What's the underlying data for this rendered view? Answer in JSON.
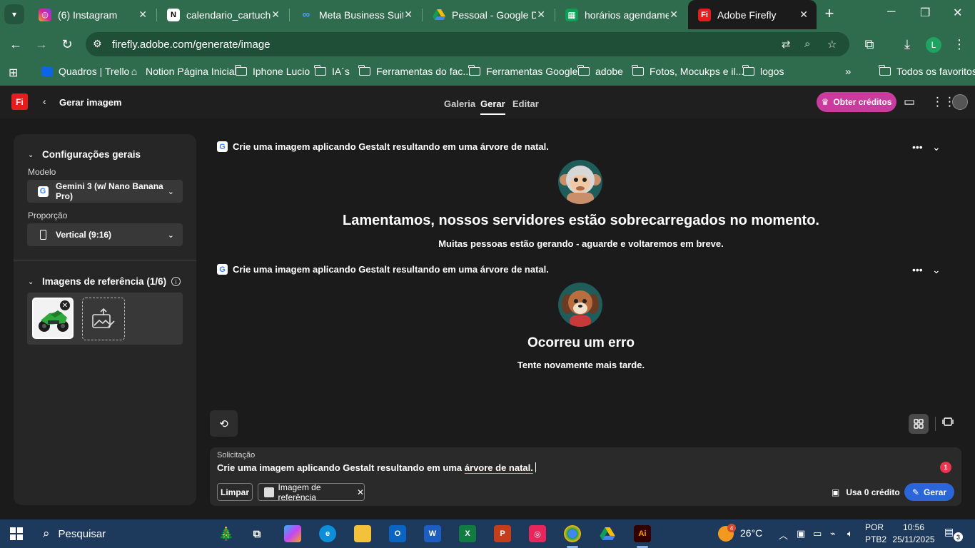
{
  "browser": {
    "tabs": [
      {
        "title": "(6) Instagram",
        "icon": "instagram-icon",
        "color": "#d6249f"
      },
      {
        "title": "calendario_cartucho_",
        "icon": "notion-icon",
        "color": "#ffffff"
      },
      {
        "title": "Meta Business Suite",
        "icon": "meta-icon",
        "color": "#1877f2"
      },
      {
        "title": "Pessoal - Google Drive",
        "icon": "google-drive-icon",
        "color": "#34a853"
      },
      {
        "title": "horários agendament",
        "icon": "google-sheets-icon",
        "color": "#0f9d58"
      },
      {
        "title": "Adobe Firefly",
        "icon": "adobe-firefly-icon",
        "color": "#e81c1c",
        "active": true
      }
    ],
    "url": "firefly.adobe.com/generate/image",
    "profile_initial": "L",
    "bookmarks": [
      {
        "label": "Quadros | Trello",
        "icon": "trello-icon"
      },
      {
        "label": "Notion Página Inicial",
        "icon": "home-icon"
      },
      {
        "label": "Iphone Lucio",
        "icon": "folder-icon"
      },
      {
        "label": "IA´s",
        "icon": "folder-icon"
      },
      {
        "label": "Ferramentas do fac...",
        "icon": "folder-icon"
      },
      {
        "label": "Ferramentas Google",
        "icon": "folder-icon"
      },
      {
        "label": "adobe",
        "icon": "folder-icon"
      },
      {
        "label": "Fotos, Mocukps e il...",
        "icon": "folder-icon"
      },
      {
        "label": "logos",
        "icon": "folder-icon"
      }
    ],
    "all_bookmarks": "Todos os favoritos"
  },
  "firefly": {
    "logo_text": "Fi",
    "page_title": "Gerar imagem",
    "nav": [
      "Galeria",
      "Gerar",
      "Editar"
    ],
    "active_nav": "Gerar",
    "credits_button": "Obter créditos",
    "accent": "#c93c9e",
    "settings": {
      "general_title": "Configurações gerais",
      "model_label": "Modelo",
      "model_value": "Gemini 3 (w/ Nano Banana Pro)",
      "ratio_label": "Proporção",
      "ratio_value": "Vertical (9:16)",
      "ref_title": "Imagens de referência (1/6)"
    },
    "results": [
      {
        "prompt": "Crie uma imagem aplicando Gestalt resultando em uma árvore de natal.",
        "title": "Lamentamos, nossos servidores estão sobrecarregados no momento.",
        "subtitle": "Muitas pessoas estão gerando - aguarde e voltaremos em breve.",
        "mascot": "monkey-mascot"
      },
      {
        "prompt": "Crie uma imagem aplicando Gestalt resultando em uma árvore de natal.",
        "title": "Ocorreu um erro",
        "subtitle": "Tente novamente mais tarde.",
        "mascot": "dog-mascot"
      }
    ],
    "prompt_box": {
      "label": "Solicitação",
      "text_start": "Crie uma imagem aplicando Gestalt resultando em uma ",
      "text_underlined": "árvore de natal.",
      "badge": "1",
      "clear_button": "Limpar",
      "ref_chip": "Imagem de referência",
      "credit_note": "Usa 0 crédito",
      "generate_button": "Gerar",
      "generate_color": "#2a66d9"
    }
  },
  "taskbar": {
    "search_placeholder": "Pesquisar",
    "weather": "26°C",
    "weather_badge": "4",
    "lang_1": "POR",
    "lang_2": "PTB2",
    "time": "10:56",
    "date": "25/11/2025",
    "notifications": "3"
  }
}
